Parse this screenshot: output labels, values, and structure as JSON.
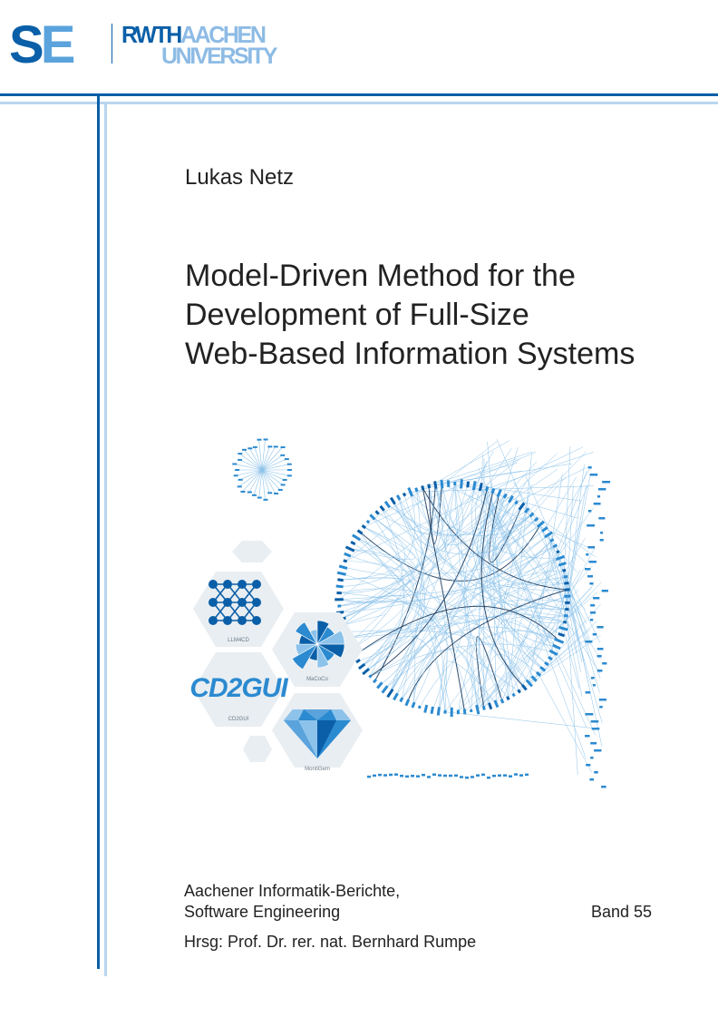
{
  "logo": {
    "se_s": "S",
    "se_e": "E",
    "rwth": "RWTH",
    "aachen": "AACHEN",
    "university": "UNIVERSITY"
  },
  "author": "Lukas Netz",
  "title_lines": [
    "Model-Driven Method for the",
    "Development of Full-Size",
    "Web-Based Information Systems"
  ],
  "illustration": {
    "hex_labels": {
      "llm4cd": "LLM4CD",
      "macoco": "MaCoCo",
      "cd2gui_logo": "CD2GUI",
      "cd2gui": "CD2GUI",
      "montigem": "MontiGem"
    },
    "colors": {
      "dark": "#0a5fa8",
      "mid": "#2b8ad0",
      "light": "#8dc3ea",
      "hex_bg": "#e9eef2"
    }
  },
  "series": {
    "line1": "Aachener Informatik-Berichte,",
    "line2": "Software Engineering",
    "band": "Band 55",
    "editor": "Hrsg:  Prof. Dr. rer. nat. Bernhard Rumpe"
  },
  "colors": {
    "primary": "#0a5fa8",
    "light": "#b9d6ef"
  }
}
